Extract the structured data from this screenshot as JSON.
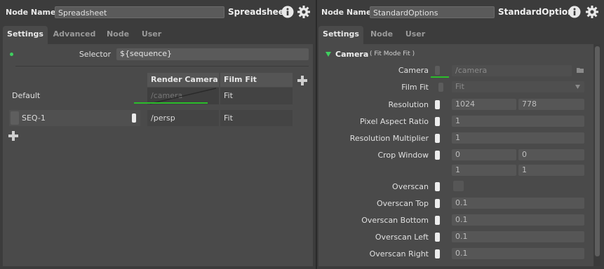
{
  "left": {
    "node_name_label": "Node Name",
    "node_name_value": "Spreadsheet",
    "node_type": "Spreadsheet",
    "tabs": [
      "Settings",
      "Advanced",
      "Node",
      "User"
    ],
    "selector_label": "Selector",
    "selector_value": "${sequence}",
    "table": {
      "columns": [
        "Render Camera",
        "Film Fit"
      ],
      "default_row": {
        "label": "Default",
        "render_camera": "/camera",
        "film_fit": "Fit"
      },
      "rows": [
        {
          "name": "SEQ-1",
          "render_camera": "/persp",
          "film_fit": "Fit"
        }
      ]
    }
  },
  "right": {
    "node_name_label": "Node Name",
    "node_name_value": "StandardOptions",
    "node_type": "StandardOptions",
    "tabs": [
      "Settings",
      "Node",
      "User"
    ],
    "section_title": "Camera",
    "section_subtitle": "( Fit Mode Fit )",
    "fields": {
      "camera": {
        "label": "Camera",
        "value": "/camera"
      },
      "film_fit": {
        "label": "Film Fit",
        "value": "Fit"
      },
      "resolution": {
        "label": "Resolution",
        "x": "1024",
        "y": "778"
      },
      "pixel_aspect": {
        "label": "Pixel Aspect Ratio",
        "value": "1"
      },
      "res_multiplier": {
        "label": "Resolution Multiplier",
        "value": "1"
      },
      "crop_window": {
        "label": "Crop Window",
        "min_x": "0",
        "min_y": "0",
        "max_x": "1",
        "max_y": "1"
      },
      "overscan": {
        "label": "Overscan"
      },
      "overscan_top": {
        "label": "Overscan Top",
        "value": "0.1"
      },
      "overscan_bottom": {
        "label": "Overscan Bottom",
        "value": "0.1"
      },
      "overscan_left": {
        "label": "Overscan Left",
        "value": "0.1"
      },
      "overscan_right": {
        "label": "Overscan Right",
        "value": "0.1"
      }
    }
  },
  "colors": {
    "accent_green": "#2bbd2b",
    "panel_bg": "#3c3c3c",
    "content_bg": "#4a4a4a"
  },
  "icons": [
    "info-icon",
    "gear-icon",
    "plus-icon",
    "triangle-down-icon",
    "folder-icon",
    "dropdown-arrow-icon"
  ]
}
